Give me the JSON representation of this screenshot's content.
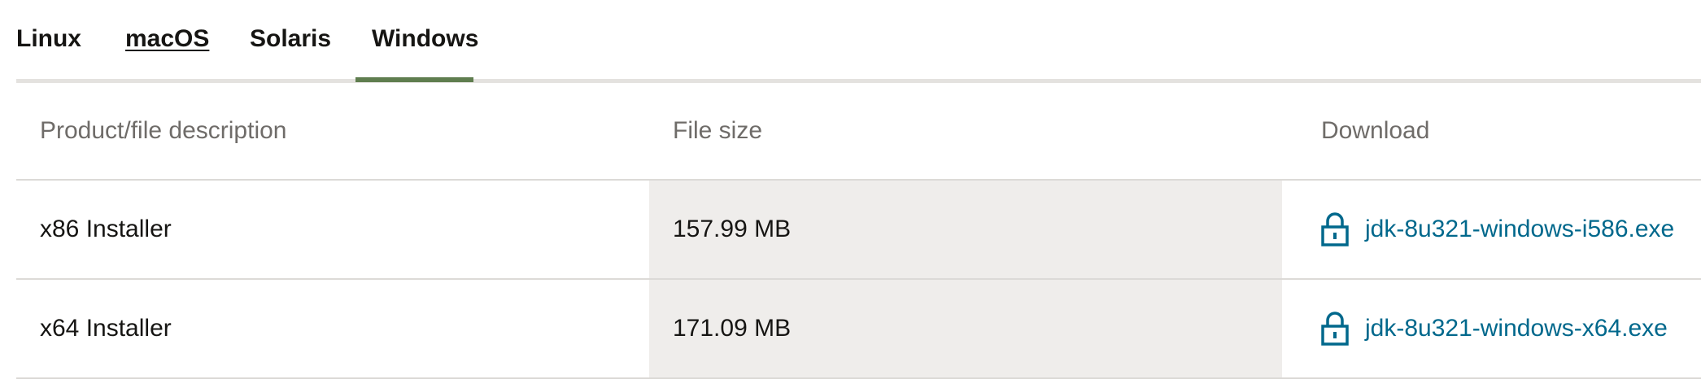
{
  "tabs": [
    {
      "label": "Linux",
      "active": false
    },
    {
      "label": "macOS",
      "active": false
    },
    {
      "label": "Solaris",
      "active": false
    },
    {
      "label": "Windows",
      "active": true
    }
  ],
  "table": {
    "headers": {
      "description": "Product/file description",
      "size": "File size",
      "download": "Download"
    },
    "rows": [
      {
        "description": "x86 Installer",
        "size": "157.99 MB",
        "file": "jdk-8u321-windows-i586.exe",
        "icon": "lock-icon"
      },
      {
        "description": "x64 Installer",
        "size": "171.09 MB",
        "file": "jdk-8u321-windows-x64.exe",
        "icon": "lock-icon"
      }
    ]
  },
  "colors": {
    "active_tab_bar": "#5f7d4f",
    "link": "#00688c",
    "size_column_bg": "#efedeb"
  }
}
